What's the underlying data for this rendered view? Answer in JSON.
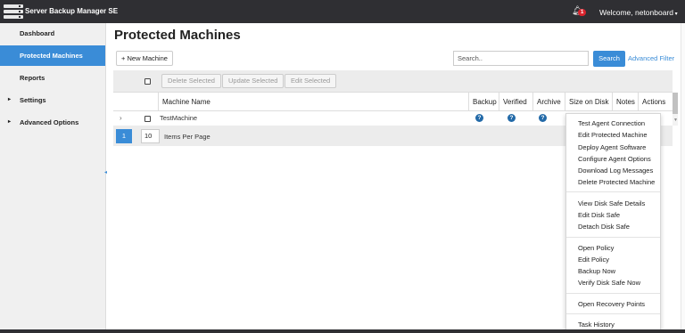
{
  "header": {
    "app_title": "Server Backup Manager SE",
    "notification_count": "1",
    "welcome": "Welcome, netonboard"
  },
  "sidebar": {
    "items": [
      {
        "label": "Dashboard"
      },
      {
        "label": "Protected Machines"
      },
      {
        "label": "Reports"
      },
      {
        "label": "Settings"
      },
      {
        "label": "Advanced Options"
      }
    ]
  },
  "main": {
    "title": "Protected Machines",
    "new_machine_label": "New Machine",
    "search_placeholder": "Search..",
    "search_button": "Search",
    "advanced_filter": "Advanced Filter"
  },
  "grid": {
    "toolbar": {
      "delete_selected": "Delete Selected",
      "update_selected": "Update Selected",
      "edit_selected": "Edit Selected"
    },
    "columns": [
      "Machine Name",
      "Backup",
      "Verified",
      "Archive",
      "Size on Disk",
      "Notes",
      "Actions"
    ],
    "rows": [
      {
        "machine_name": "TestMachine"
      }
    ],
    "pager": {
      "current_page": "1",
      "items_per_page": "10",
      "items_per_page_label": "Items Per Page"
    }
  },
  "actions_menu": {
    "groups": [
      [
        "Test Agent Connection",
        "Edit Protected Machine",
        "Deploy Agent Software",
        "Configure Agent Options",
        "Download Log Messages",
        "Delete Protected Machine"
      ],
      [
        "View Disk Safe Details",
        "Edit Disk Safe",
        "Detach Disk Safe"
      ],
      [
        "Open Policy",
        "Edit Policy",
        "Backup Now",
        "Verify Disk Safe Now"
      ],
      [
        "Open Recovery Points"
      ],
      [
        "Task History"
      ]
    ]
  },
  "colors": {
    "topbar": "#2f2f33",
    "accent": "#3a8cd7",
    "badge": "#d9232d",
    "icon_blue": "#236aa8"
  }
}
